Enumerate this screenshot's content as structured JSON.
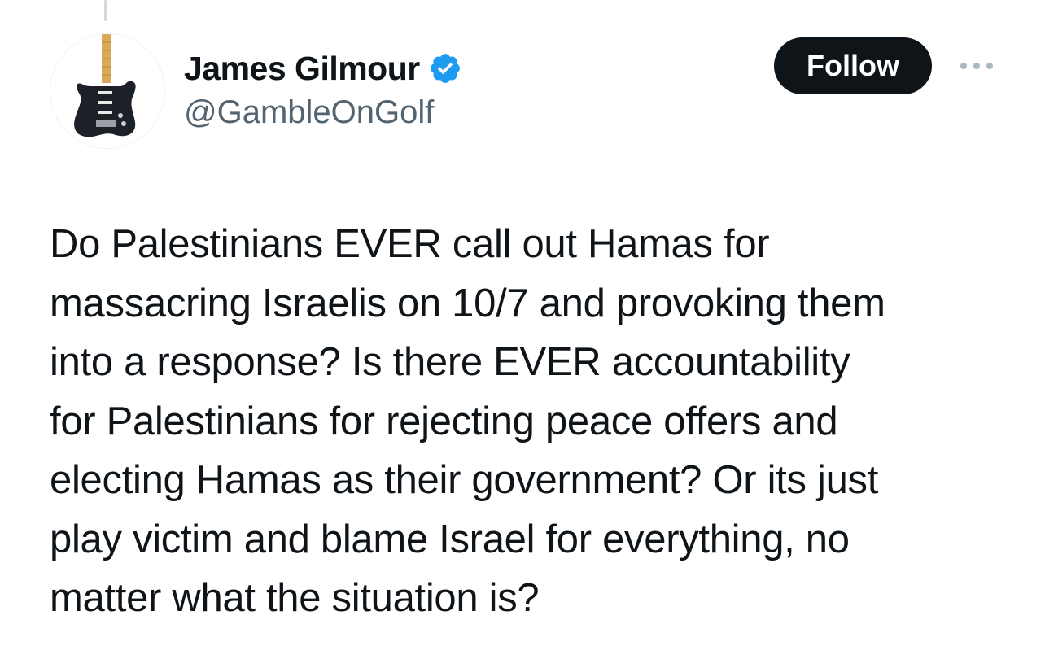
{
  "author": {
    "display_name": "James Gilmour",
    "handle": "@GambleOnGolf",
    "verified": true,
    "avatar_icon": "guitar-avatar-icon",
    "verified_icon": "verified-badge-icon"
  },
  "actions": {
    "follow_label": "Follow",
    "more_icon": "more-options-icon"
  },
  "tweet": {
    "lines": [
      "Do Palestinians EVER call out Hamas for",
      "massacring Israelis on 10/7 and provoking them",
      "into a response? Is there EVER accountability",
      "for Palestinians for rejecting peace offers and",
      "electing Hamas as their government? Or its just",
      "play victim and blame Israel for everything, no",
      "matter what the situation is?"
    ]
  },
  "colors": {
    "text_primary": "#0f1419",
    "text_secondary": "#536471",
    "verified_blue": "#1d9bf0",
    "follow_bg": "#0f1419",
    "follow_text": "#ffffff"
  }
}
